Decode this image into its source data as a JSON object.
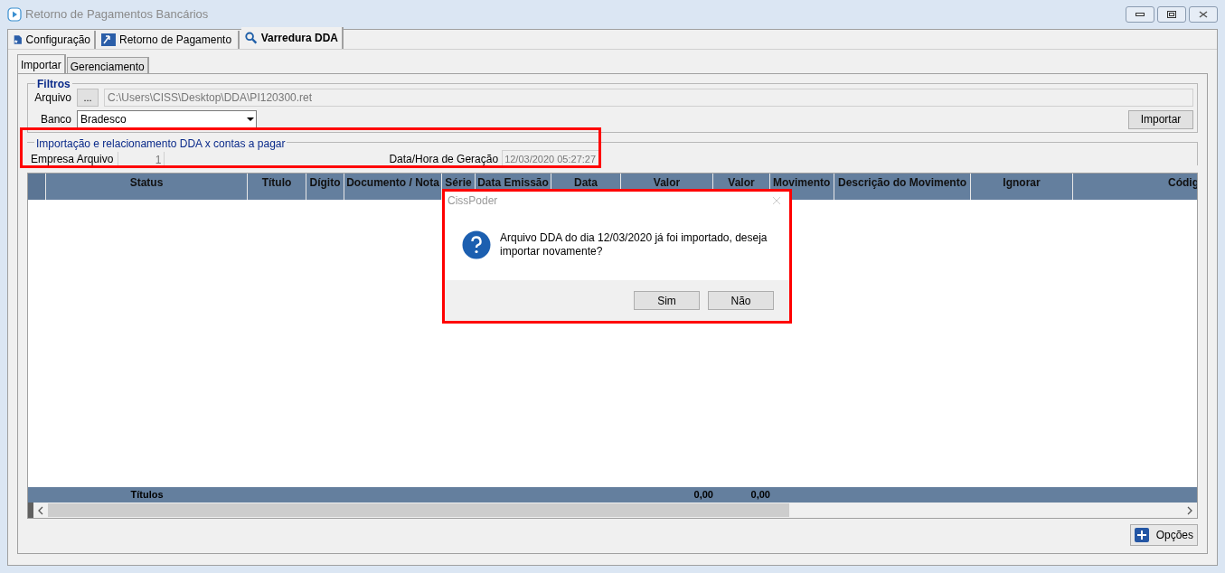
{
  "window": {
    "title": "Retorno de Pagamentos Bancários"
  },
  "tabs": [
    {
      "label": "Configuração",
      "selected": false
    },
    {
      "label": "Retorno de Pagamento",
      "selected": false
    },
    {
      "label": "Varredura DDA",
      "selected": true
    }
  ],
  "subtabs": [
    {
      "label": "Importar",
      "selected": true
    },
    {
      "label": "Gerenciamento",
      "selected": false
    }
  ],
  "filtros": {
    "title": "Filtros",
    "arquivo_label": "Arquivo",
    "browse_button": "...",
    "arquivo_value": "C:\\Users\\CISS\\Desktop\\DDA\\PI120300.ret",
    "banco_label": "Banco",
    "banco_value": "Bradesco",
    "import_button": "Importar"
  },
  "importacao": {
    "title": "Importação e relacionamento DDA x contas a pagar",
    "empresa_label": "Empresa Arquivo",
    "empresa_value": "1",
    "data_label": "Data/Hora de Geração",
    "data_value": "12/03/2020 05:27:27"
  },
  "table": {
    "columns": [
      {
        "label": "Status"
      },
      {
        "label": "Título"
      },
      {
        "label": "Dígito"
      },
      {
        "label": "Documento / Nota"
      },
      {
        "label": "Série"
      },
      {
        "label": "Data Emissão"
      },
      {
        "label": "Data"
      },
      {
        "label": "Valor"
      },
      {
        "label": "Valor"
      },
      {
        "label": "Movimento"
      },
      {
        "label": "Descrição do Movimento"
      },
      {
        "label": "Ignorar"
      },
      {
        "label": "Códig"
      }
    ],
    "footer": {
      "label": "Títulos",
      "total_1": "0,00",
      "total_2": "0,00"
    }
  },
  "options_button": "Opções",
  "dialog": {
    "title": "CissPoder",
    "message": "Arquivo DDA do dia 12/03/2020 já foi importado, deseja importar novamente?",
    "buttons": [
      {
        "label": "Sim"
      },
      {
        "label": "Não"
      }
    ]
  }
}
